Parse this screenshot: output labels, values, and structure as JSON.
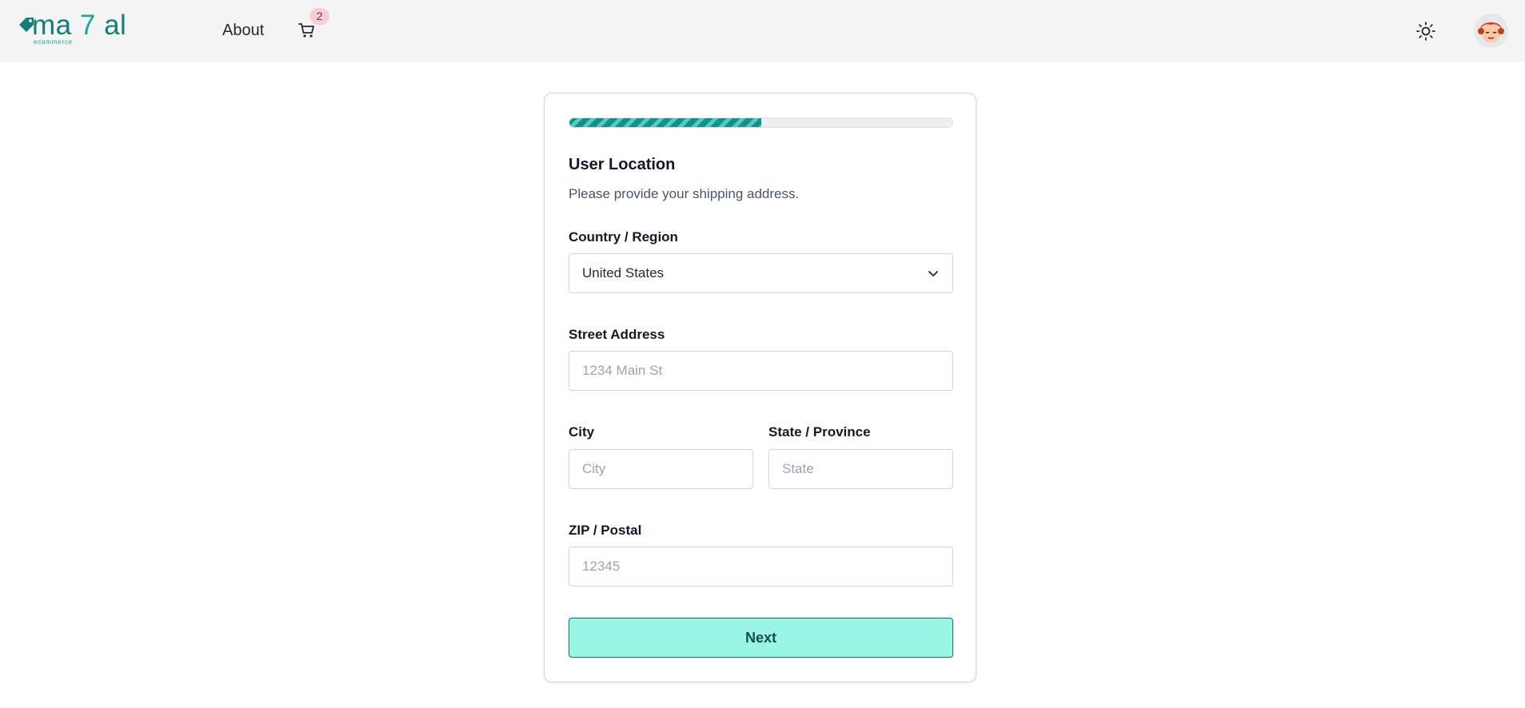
{
  "navbar": {
    "logo_text_a": "ma",
    "logo_text_seven": "7",
    "logo_text_b": "al",
    "logo_sub": "ecommerce",
    "about_label": "About",
    "cart_count": "2",
    "theme_icon": "sun-icon",
    "cart_icon": "cart-icon"
  },
  "form": {
    "progress_fraction": 0.5,
    "title": "User Location",
    "description": "Please provide your shipping address.",
    "country": {
      "label": "Country / Region",
      "value": "United States"
    },
    "street": {
      "label": "Street Address",
      "placeholder": "1234 Main St"
    },
    "city": {
      "label": "City",
      "placeholder": "City"
    },
    "state": {
      "label": "State / Province",
      "placeholder": "State"
    },
    "zip": {
      "label": "ZIP / Postal",
      "placeholder": "12345"
    },
    "next_label": "Next"
  },
  "colors": {
    "brand": "#0f7f77",
    "brand_light": "#14a89b",
    "next_button": "#99f6e4",
    "badge": "#fecdd3"
  }
}
